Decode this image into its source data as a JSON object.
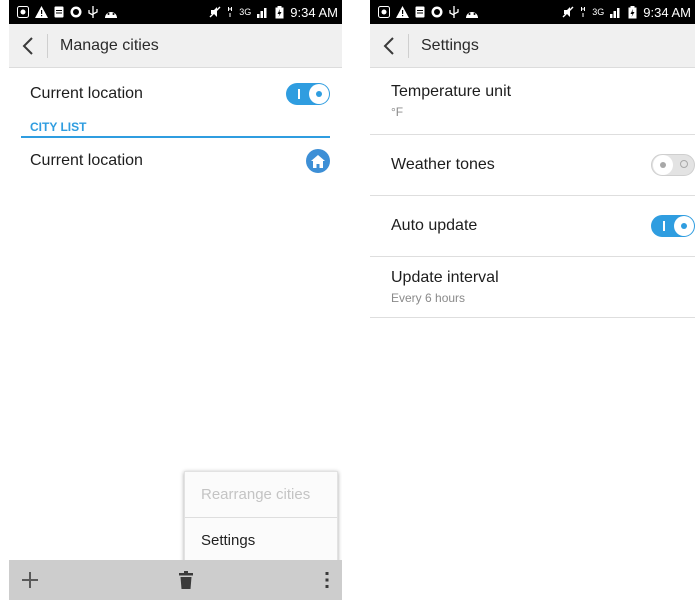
{
  "status_bar": {
    "icons_left": [
      "screenshot-icon",
      "warning-icon",
      "sim-icon",
      "globe-icon",
      "usb-icon",
      "android-icon"
    ],
    "icons_right": [
      "mute-icon",
      "hspa-icon",
      "signal-3g-icon",
      "battery-icon"
    ],
    "network_label": "3G",
    "time": "9:34 AM"
  },
  "left": {
    "title": "Manage cities",
    "current_location_toggle": {
      "label": "Current location",
      "on": true
    },
    "section_header": "CITY LIST",
    "city_item": {
      "label": "Current location"
    },
    "overflow_menu": {
      "items": [
        {
          "label": "Rearrange cities",
          "enabled": false
        },
        {
          "label": "Settings",
          "enabled": true
        }
      ]
    },
    "bottom_bar": [
      "add-icon",
      "delete-icon",
      "more-icon"
    ]
  },
  "right": {
    "title": "Settings",
    "items": [
      {
        "label": "Temperature unit",
        "summary": "°F"
      },
      {
        "label": "Weather tones",
        "toggle_on": false
      },
      {
        "label": "Auto update",
        "toggle_on": true
      },
      {
        "label": "Update interval",
        "summary": "Every 6 hours"
      }
    ]
  },
  "colors": {
    "accent": "#2f9de0",
    "toggle_off": "#e3e3e3",
    "action_bar": "#f0f0f0",
    "bottom_bar": "#cdcdcd"
  }
}
